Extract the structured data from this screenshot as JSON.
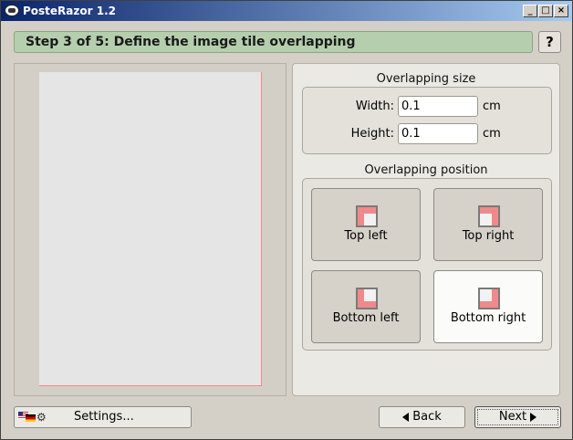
{
  "window": {
    "title": "PosteRazor 1.2",
    "minimize": "_",
    "maximize": "□",
    "close": "×"
  },
  "step": {
    "title": "Step 3 of 5: Define the image tile overlapping",
    "help_label": "?"
  },
  "overlapping_size": {
    "label": "Overlapping size",
    "width_label": "Width:",
    "width_value": "0.1",
    "height_label": "Height:",
    "height_value": "0.1",
    "unit": "cm"
  },
  "overlapping_position": {
    "label": "Overlapping position",
    "options": [
      {
        "label": "Top left"
      },
      {
        "label": "Top right"
      },
      {
        "label": "Bottom left"
      },
      {
        "label": "Bottom right"
      }
    ],
    "selected": "Bottom right"
  },
  "footer": {
    "settings_label": "Settings...",
    "back_label": "Back",
    "next_label": "Next"
  },
  "colors": {
    "step_bar": "#b5cfae",
    "overlap_marker": "#f08a8a"
  }
}
